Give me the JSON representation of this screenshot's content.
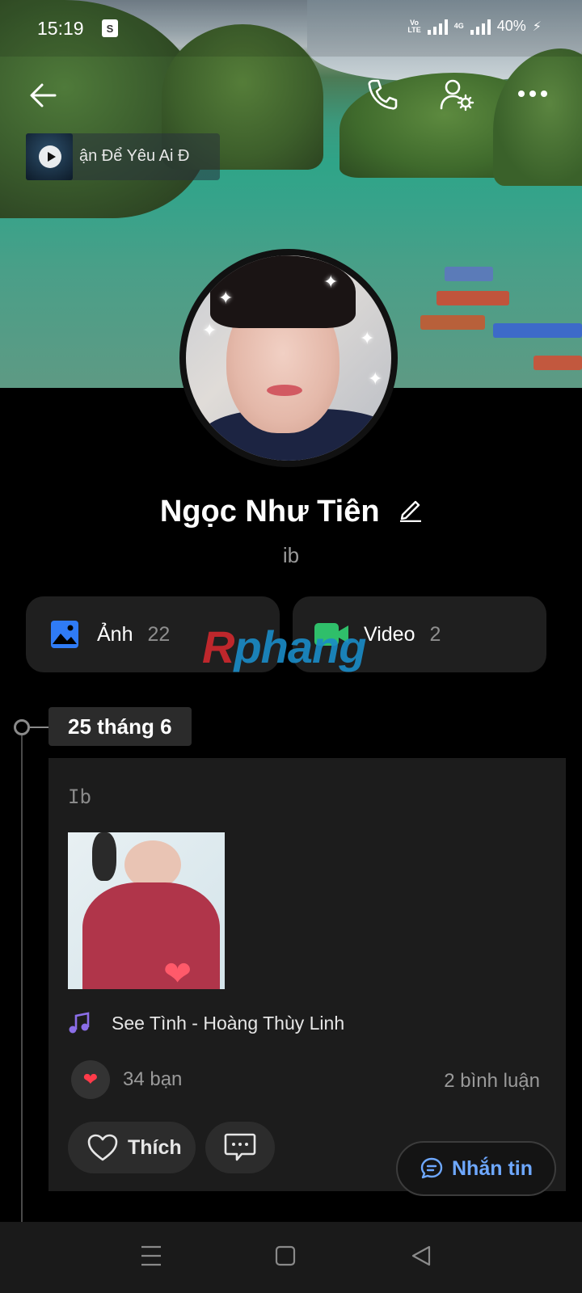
{
  "status_bar": {
    "time": "15:19",
    "volte": "Vo LTE",
    "network": "4G",
    "battery": "40%"
  },
  "cover": {
    "music_title": "ận Để Yêu Ai Đ"
  },
  "profile": {
    "name": "Ngọc Như Tiên",
    "bio": "ib"
  },
  "media": {
    "photos_label": "Ảnh",
    "photos_count": "22",
    "video_label": "Video",
    "video_count": "2"
  },
  "watermark": {
    "r": "R",
    "rest": "phang"
  },
  "timeline": {
    "date": "25 tháng 6"
  },
  "post": {
    "text": "Ib",
    "song": "See Tình - Hoàng Thùy Linh",
    "likes": "34 bạn",
    "comments": "2 bình luận",
    "like_button": "Thích"
  },
  "message_button": "Nhắn tin",
  "colors": {
    "accent_blue": "#6ea8ff",
    "photo_icon": "#2f7bf5",
    "video_icon": "#2fbf6a",
    "music_icon": "#8b6ee8",
    "heart": "#ff3b4a"
  }
}
